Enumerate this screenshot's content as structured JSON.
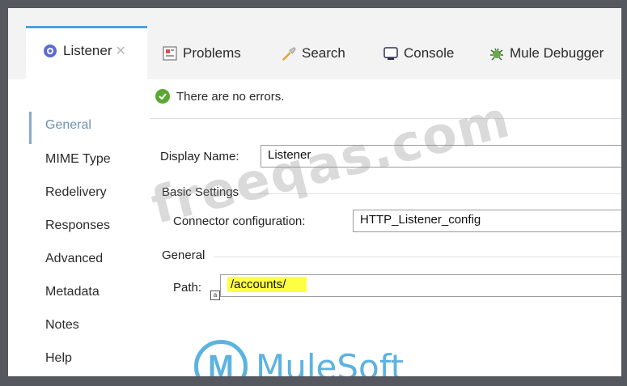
{
  "tabs": [
    {
      "label": "Listener",
      "icon": "listener-icon",
      "active": true,
      "closable": true
    },
    {
      "label": "Problems",
      "icon": "problems-icon"
    },
    {
      "label": "Search",
      "icon": "search-icon"
    },
    {
      "label": "Console",
      "icon": "console-icon"
    },
    {
      "label": "Mule Debugger",
      "icon": "debugger-icon"
    }
  ],
  "status": {
    "text": "There are no errors.",
    "icon": "ok-check-icon"
  },
  "nav": {
    "items": [
      "General",
      "MIME Type",
      "Redelivery",
      "Responses",
      "Advanced",
      "Metadata",
      "Notes",
      "Help"
    ],
    "active": "General"
  },
  "form": {
    "display_name_label": "Display Name:",
    "display_name_value": "Listener",
    "basic_settings_label": "Basic Settings",
    "connector_label": "Connector configuration:",
    "connector_value": "HTTP_Listener_config",
    "general_label": "General",
    "path_label": "Path:",
    "path_value": "/accounts/"
  },
  "watermark": "freeqas.com",
  "logo_text": "MuleSoft",
  "colors": {
    "accent": "#4aa3df",
    "ok": "#5aa832",
    "highlight": "#ffff44",
    "mulesoft": "#5cb3e0"
  }
}
